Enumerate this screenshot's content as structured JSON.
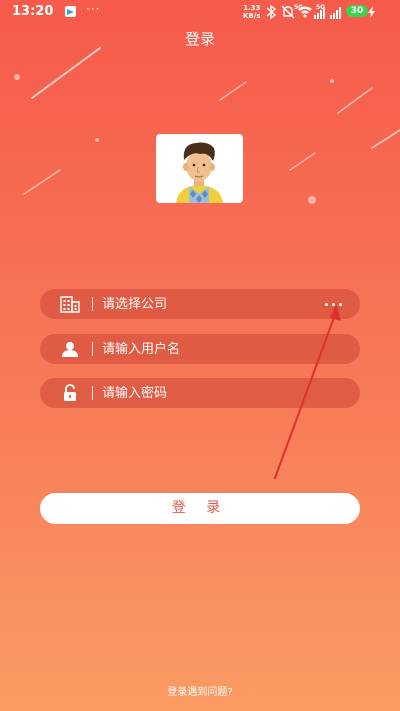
{
  "status_bar": {
    "time": "13:20",
    "dots": "···",
    "network_speed_value": "1.33",
    "network_speed_unit": "KB/s",
    "signal_label_1": "5G",
    "signal_label_2": "5G",
    "battery_level": "30"
  },
  "header": {
    "title": "登录"
  },
  "form": {
    "company_placeholder": "请选择公司",
    "username_placeholder": "请输入用户名",
    "password_placeholder": "请输入密码"
  },
  "login_button_label": "登 录",
  "help_link_label": "登录遇到问题?",
  "colors": {
    "gradient_top": "#f65a4a",
    "gradient_bottom": "#fb9b63",
    "accent_text": "#e8574a",
    "annotation_arrow": "#e0302c"
  },
  "icons": [
    "notification-icon",
    "bluetooth-icon",
    "mute-icon",
    "wifi-icon",
    "signal-icon",
    "charging-icon",
    "building-icon",
    "user-icon",
    "lock-icon",
    "more-icon"
  ]
}
